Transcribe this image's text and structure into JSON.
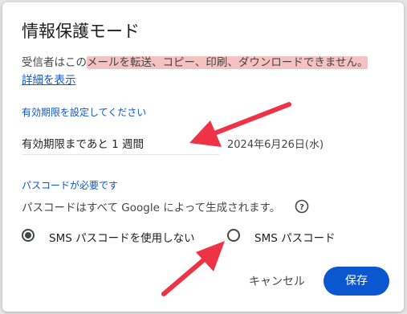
{
  "dialog": {
    "title": "情報保護モード",
    "description_prefix": "受信者はこの",
    "description_highlight": "メールを転送、コピー、印刷、ダウンロードできません。",
    "details_link": "詳細を表示"
  },
  "expiry": {
    "label": "有効期限を設定してください",
    "selected": "有効期限まであと 1 週間",
    "date": "2024年6月26日(水)"
  },
  "passcode": {
    "label": "パスコードが必要です",
    "description": "パスコードはすべて Google によって生成されます。",
    "options": [
      {
        "label": "SMS パスコードを使用しない",
        "selected": true
      },
      {
        "label": "SMS パスコード",
        "selected": false
      }
    ]
  },
  "buttons": {
    "cancel": "キャンセル",
    "save": "保存"
  },
  "colors": {
    "accent": "#0b57d0",
    "highlight": "#f6c1c1",
    "annotation_arrow": "#ee3347"
  },
  "icons": {
    "help": "help-circle-icon",
    "dropdown": "caret-down-icon",
    "annotation": "red-arrow"
  }
}
